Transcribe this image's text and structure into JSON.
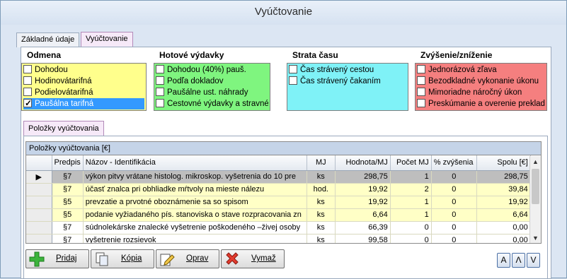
{
  "window": {
    "title": "Vyúčtovanie"
  },
  "tabs": [
    {
      "label": "Základné údaje",
      "active": false
    },
    {
      "label": "Vyúčtovanie",
      "active": true
    }
  ],
  "groups": {
    "odmena": {
      "title": "Odmena",
      "items": [
        "Dohodou",
        "Hodinovátarifná",
        "Podielovátarifná",
        "Paušálna tarifná"
      ],
      "checked_index": 3
    },
    "hotove": {
      "title": "Hotové výdavky",
      "items": [
        "Dohodou (40%) pauš.",
        "Podľa dokladov",
        "Paušálne ust. náhrady",
        "Cestovné výdavky a stravné"
      ]
    },
    "strata": {
      "title": "Strata času",
      "items": [
        "Čas strávený cestou",
        "Čas strávený čakaním"
      ]
    },
    "zvysenie": {
      "title": "Zvýšenie/zníženie",
      "items": [
        "Jednorázová zľava",
        "Bezodkladné vykonanie úkonu",
        "Mimoriadne náročný úkon",
        "Preskúmanie a overenie prekladu"
      ]
    }
  },
  "items_tab": {
    "label": "Položky vyúčtovania"
  },
  "grid": {
    "caption": "Položky vyúčtovania   [€]",
    "columns": [
      "Predpis",
      "Názov - Identifikácia",
      "MJ",
      "Hodnota/MJ",
      "Počet MJ",
      "% zvýšenia",
      "Spolu [€]"
    ],
    "rows": [
      {
        "predpis": "§7",
        "nazov": "výkon pitvy vrátane histolog. mikroskop. vyšetrenia do 10 pre",
        "mj": "ks",
        "hodnota": "298,75",
        "pocet": "1",
        "zvysenie": "0",
        "spolu": "298,75",
        "selected": true
      },
      {
        "predpis": "§7",
        "nazov": "účasť znalca pri obhliadke mŕtvoly na mieste nálezu",
        "mj": "hod.",
        "hodnota": "19,92",
        "pocet": "2",
        "zvysenie": "0",
        "spolu": "39,84"
      },
      {
        "predpis": "§5",
        "nazov": "prevzatie a prvotné oboznámenie sa so spisom",
        "mj": "ks",
        "hodnota": "19,92",
        "pocet": "1",
        "zvysenie": "0",
        "spolu": "19,92"
      },
      {
        "predpis": "§5",
        "nazov": "podanie vyžiadaného pís. stanoviska o stave rozpracovania zn",
        "mj": "ks",
        "hodnota": "6,64",
        "pocet": "1",
        "zvysenie": "0",
        "spolu": "6,64"
      },
      {
        "predpis": "§7",
        "nazov": "súdnolekárske znalecké vyšetrenie poškodeného –živej osoby",
        "mj": "ks",
        "hodnota": "66,39",
        "pocet": "0",
        "zvysenie": "0",
        "spolu": "0,00"
      },
      {
        "predpis": "§7",
        "nazov": "vyšetrenie rozsievok",
        "mj": "ks",
        "hodnota": "99,58",
        "pocet": "0",
        "zvysenie": "0",
        "spolu": "0,00"
      }
    ]
  },
  "buttons": {
    "add": "Pridaj",
    "copy": "Kópia",
    "edit": "Oprav",
    "delete": "Vymaž"
  },
  "sort_buttons": [
    "A",
    "Λ",
    "V"
  ],
  "icons": {
    "add": "plus-icon",
    "copy": "copy-icon",
    "edit": "edit-icon",
    "delete": "delete-icon"
  },
  "colors": {
    "yellow": "#ffff8c",
    "green": "#7ff57f",
    "cyan": "#7ff2f7",
    "red": "#f57f7f",
    "selection": "#3399ff"
  }
}
